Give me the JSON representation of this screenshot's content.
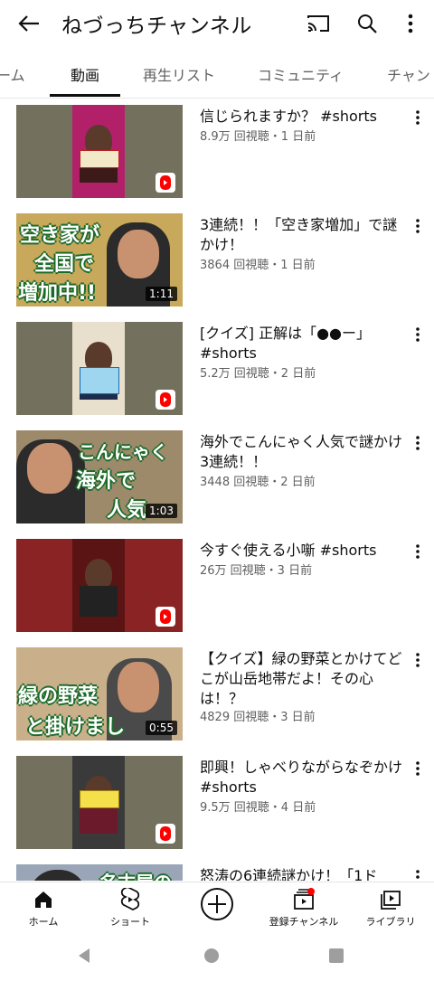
{
  "header": {
    "channel_name": "ねづっちチャンネル",
    "back_icon": "back-arrow-icon",
    "cast_icon": "cast-icon",
    "search_icon": "search-icon",
    "more_icon": "more-vert-icon"
  },
  "tabs": [
    {
      "label": "ーム",
      "active": false
    },
    {
      "label": "動画",
      "active": true
    },
    {
      "label": "再生リスト",
      "active": false
    },
    {
      "label": "コミュニティ",
      "active": false
    },
    {
      "label": "チャン",
      "active": false
    }
  ],
  "videos": [
    {
      "title": "信じられますか？ #shorts",
      "meta": "8.9万 回視聴・1 日前",
      "type": "short"
    },
    {
      "title": "3連続！！「空き家増加」で謎かけ！",
      "meta": "3864 回視聴・1 日前",
      "type": "video",
      "duration": "1:11",
      "thumb_text": [
        "空き家が",
        "全国で",
        "増加中!!"
      ]
    },
    {
      "title": "[クイズ] 正解は「●●ー」#shorts",
      "meta": "5.2万 回視聴・2 日前",
      "type": "short"
    },
    {
      "title": "海外でこんにゃく人気で謎かけ3連続！！",
      "meta": "3448 回視聴・2 日前",
      "type": "video",
      "duration": "1:03",
      "thumb_text": [
        "こんにゃく",
        "海外で",
        "人気"
      ]
    },
    {
      "title": "今すぐ使える小噺 #shorts",
      "meta": "26万 回視聴・3 日前",
      "type": "short"
    },
    {
      "title": "【クイズ】緑の野菜とかけてどこが山岳地帯だよ！その心は！？",
      "meta": "4829 回視聴・3 日前",
      "type": "video",
      "duration": "0:55",
      "thumb_text": [
        "緑の野菜",
        "と掛けまし"
      ]
    },
    {
      "title": "即興！しゃべりながらなぞかけ #shorts",
      "meta": "9.5万 回視聴・4 日前",
      "type": "short"
    },
    {
      "title": "怒涛の6連続謎かけ！「1ド",
      "meta": "",
      "type": "video",
      "thumb_text": [
        "名古屋の"
      ]
    }
  ],
  "bottom_nav": [
    {
      "label": "ホーム",
      "icon": "home-icon"
    },
    {
      "label": "ショート",
      "icon": "shorts-icon"
    },
    {
      "label": "",
      "icon": "create-plus-icon"
    },
    {
      "label": "登録チャンネル",
      "icon": "subscriptions-icon"
    },
    {
      "label": "ライブラリ",
      "icon": "library-icon"
    }
  ],
  "system_nav": {
    "back": "system-back-icon",
    "home": "system-home-icon",
    "recents": "system-recents-icon"
  },
  "colors": {
    "accent": "#ff0000",
    "text": "#0f0f0f",
    "secondary": "#606060"
  }
}
